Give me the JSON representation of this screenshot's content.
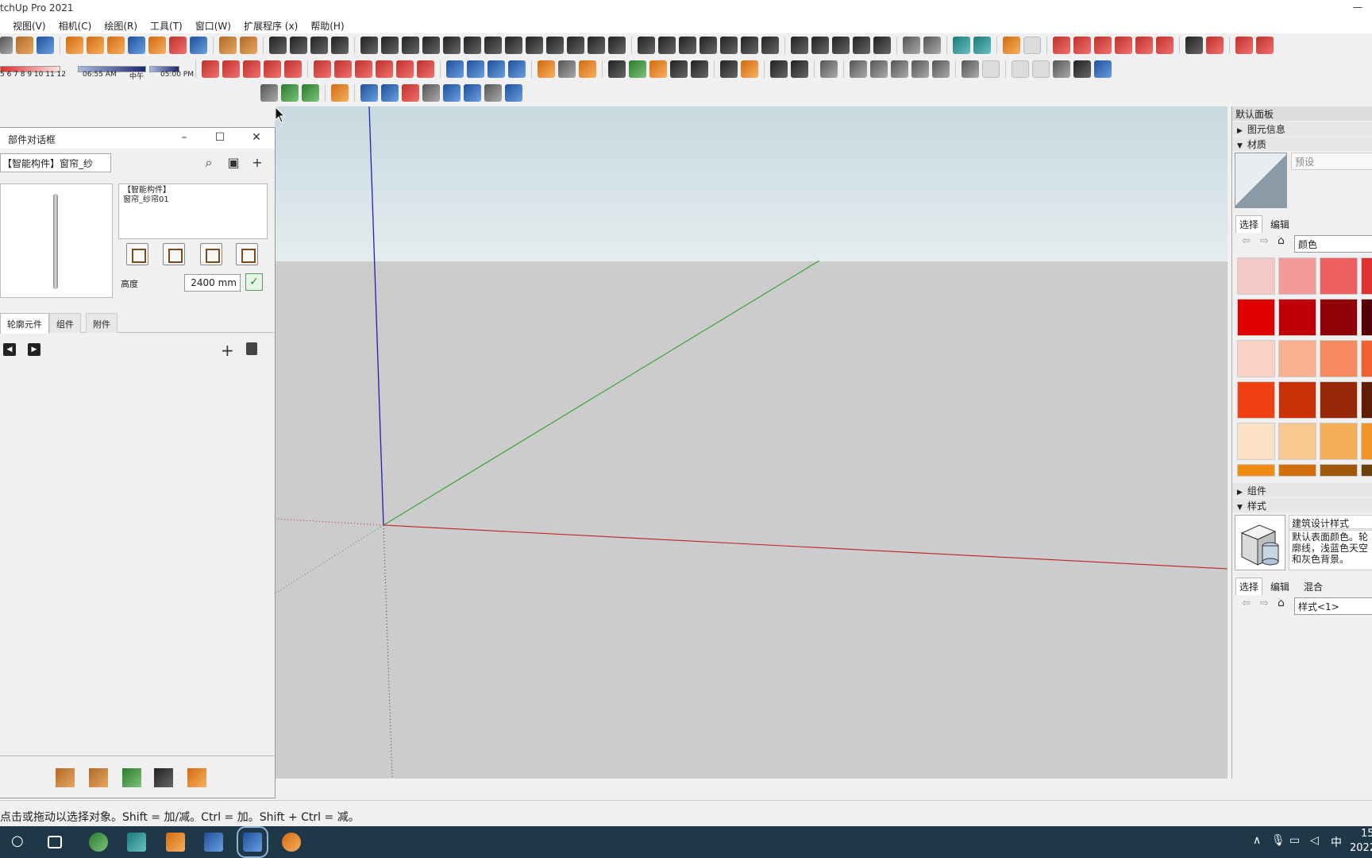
{
  "window": {
    "title": "tchUp Pro 2021"
  },
  "menu": [
    "视图(V)",
    "相机(C)",
    "绘图(R)",
    "工具(T)",
    "窗口(W)",
    "扩展程序 (x)",
    "帮助(H)"
  ],
  "shadow_toolbar": {
    "months": "5 6 7 8 9 10 11 12",
    "time_start": "06:55 AM",
    "noon": "中午",
    "time_end": "05:00 PM"
  },
  "component_dialog": {
    "title": "部件对话框",
    "search_value": "【智能构件】窗帘_纱",
    "description_line1": "【智能构件】",
    "description_line2": "窗帘_纱帘01",
    "height_label": "高度",
    "height_value": "2400 mm",
    "tabs": [
      "轮廓元件",
      "组件",
      "附件"
    ],
    "active_tab": "轮廓元件"
  },
  "tray": {
    "header": "默认面板",
    "entity_info": "图元信息",
    "materials": "材质",
    "material_name_placeholder": "预设",
    "tab_select": "选择",
    "tab_edit": "编辑",
    "material_collection": "颜色",
    "swatches": [
      [
        "#f5c8c8",
        "#f39a9a",
        "#ee6060",
        "#e03030"
      ],
      [
        "#e00000",
        "#c00008",
        "#900008",
        "#580008"
      ],
      [
        "#fcd2c6",
        "#f8b090",
        "#f58a60",
        "#f06030"
      ],
      [
        "#ee4010",
        "#c83008",
        "#962808",
        "#5e1e08"
      ],
      [
        "#fce0c6",
        "#f8c890",
        "#f5ae58",
        "#f09628"
      ],
      [
        "#f08a10",
        "#d27008",
        "#a05808",
        "#684008"
      ]
    ],
    "components": "组件",
    "styles": "样式",
    "style_name": "建筑设计样式",
    "style_description": "默认表面颜色。轮廓线，浅蓝色天空和灰色背景。",
    "style_tab_mix": "混合",
    "style_collection": "样式<1>"
  },
  "status": {
    "text": "点击或拖动以选择对象。Shift = 加/减。Ctrl = 加。Shift + Ctrl = 减。"
  },
  "taskbar": {
    "ime": "中",
    "time": "15",
    "date": "2022"
  },
  "colors": {
    "axis_blue": "#2020b0",
    "axis_green": "#30a030",
    "axis_red": "#c02020",
    "sky_top": "#c7d9e0",
    "ground": "#cccccc",
    "taskbar": "#1e3848"
  }
}
